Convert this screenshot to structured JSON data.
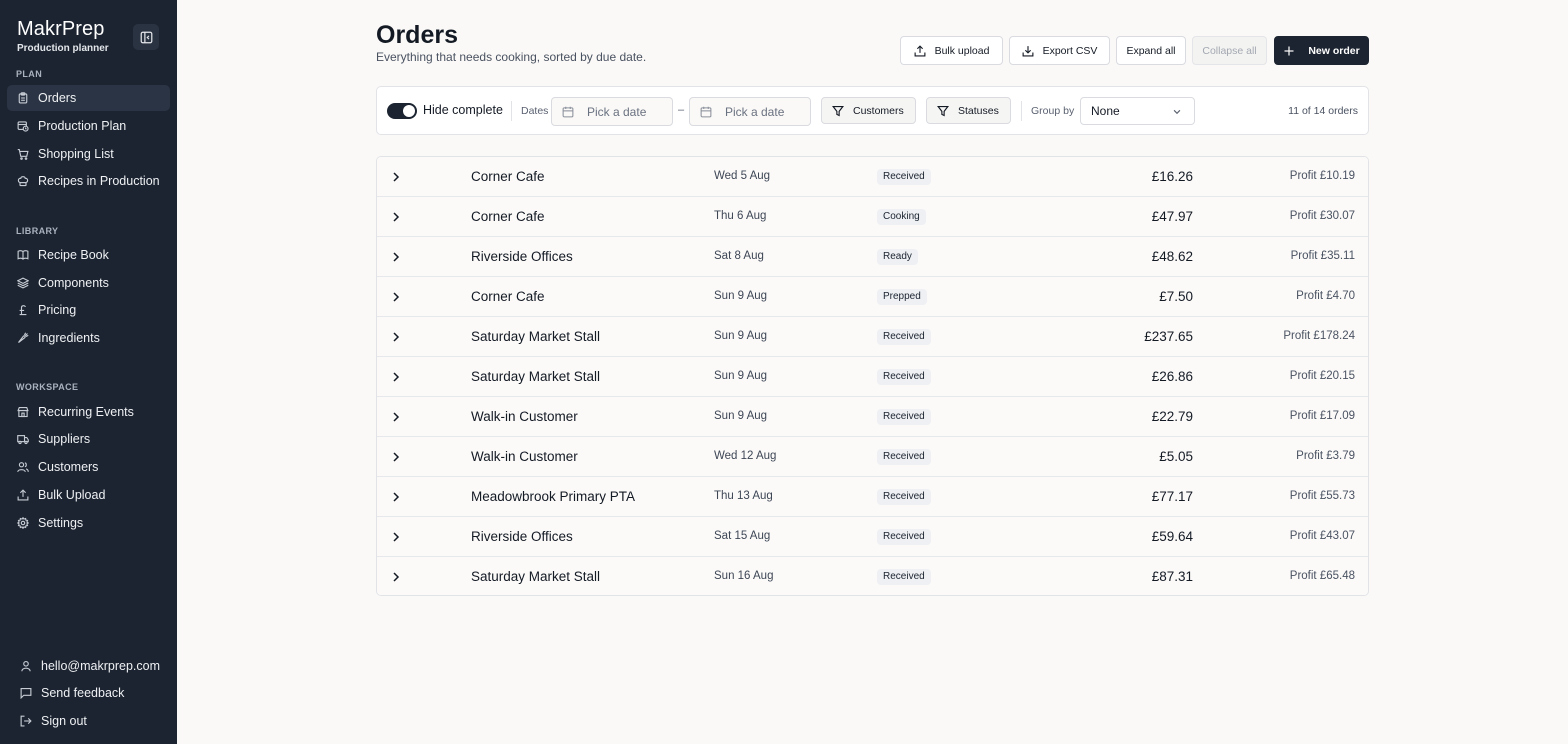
{
  "brand": {
    "title": "MakrPrep",
    "subtitle": "Production planner"
  },
  "sidebar": {
    "sections": [
      {
        "label": "PLAN",
        "items": [
          {
            "label": "Orders",
            "icon": "clipboard-icon",
            "active": true
          },
          {
            "label": "Production Plan",
            "icon": "calendar-clock-icon"
          },
          {
            "label": "Shopping List",
            "icon": "cart-icon"
          },
          {
            "label": "Recipes in Production",
            "icon": "chef-hat-icon"
          }
        ]
      },
      {
        "label": "LIBRARY",
        "items": [
          {
            "label": "Recipe Book",
            "icon": "book-icon"
          },
          {
            "label": "Components",
            "icon": "layers-icon"
          },
          {
            "label": "Pricing",
            "icon": "pound-icon"
          },
          {
            "label": "Ingredients",
            "icon": "carrot-icon"
          }
        ]
      },
      {
        "label": "WORKSPACE",
        "items": [
          {
            "label": "Recurring Events",
            "icon": "store-icon"
          },
          {
            "label": "Suppliers",
            "icon": "truck-icon"
          },
          {
            "label": "Customers",
            "icon": "users-icon"
          },
          {
            "label": "Bulk Upload",
            "icon": "upload-icon"
          },
          {
            "label": "Settings",
            "icon": "gear-icon"
          }
        ]
      }
    ],
    "footer": {
      "email": "hello@makrprep.com",
      "feedback": "Send feedback",
      "signout": "Sign out"
    }
  },
  "header": {
    "title": "Orders",
    "subtitle": "Everything that needs cooking, sorted by due date.",
    "buttons": {
      "bulk_upload": "Bulk upload",
      "export_csv": "Export CSV",
      "expand_all": "Expand all",
      "collapse_all": "Collapse all",
      "new_order": "New order"
    }
  },
  "filters": {
    "hide_complete_label": "Hide complete",
    "hide_complete_on": true,
    "dates_label": "Dates",
    "date_from_placeholder": "Pick a date",
    "date_separator": "–",
    "date_to_placeholder": "Pick a date",
    "customers_label": "Customers",
    "statuses_label": "Statuses",
    "group_by_label": "Group by",
    "group_by_value": "None",
    "count_text": "11 of 14 orders"
  },
  "orders": [
    {
      "customer": "Corner Cafe",
      "date": "Wed 5 Aug",
      "status": "Received",
      "total": "£16.26",
      "profit": "Profit £10.19"
    },
    {
      "customer": "Corner Cafe",
      "date": "Thu 6 Aug",
      "status": "Cooking",
      "total": "£47.97",
      "profit": "Profit £30.07"
    },
    {
      "customer": "Riverside Offices",
      "date": "Sat 8 Aug",
      "status": "Ready",
      "total": "£48.62",
      "profit": "Profit £35.11"
    },
    {
      "customer": "Corner Cafe",
      "date": "Sun 9 Aug",
      "status": "Prepped",
      "total": "£7.50",
      "profit": "Profit £4.70"
    },
    {
      "customer": "Saturday Market Stall",
      "date": "Sun 9 Aug",
      "status": "Received",
      "total": "£237.65",
      "profit": "Profit £178.24"
    },
    {
      "customer": "Saturday Market Stall",
      "date": "Sun 9 Aug",
      "status": "Received",
      "total": "£26.86",
      "profit": "Profit £20.15"
    },
    {
      "customer": "Walk-in Customer",
      "date": "Sun 9 Aug",
      "status": "Received",
      "total": "£22.79",
      "profit": "Profit £17.09"
    },
    {
      "customer": "Walk-in Customer",
      "date": "Wed 12 Aug",
      "status": "Received",
      "total": "£5.05",
      "profit": "Profit £3.79"
    },
    {
      "customer": "Meadowbrook Primary PTA",
      "date": "Thu 13 Aug",
      "status": "Received",
      "total": "£77.17",
      "profit": "Profit £55.73"
    },
    {
      "customer": "Riverside Offices",
      "date": "Sat 15 Aug",
      "status": "Received",
      "total": "£59.64",
      "profit": "Profit £43.07"
    },
    {
      "customer": "Saturday Market Stall",
      "date": "Sun 16 Aug",
      "status": "Received",
      "total": "£87.31",
      "profit": "Profit £65.48"
    }
  ]
}
